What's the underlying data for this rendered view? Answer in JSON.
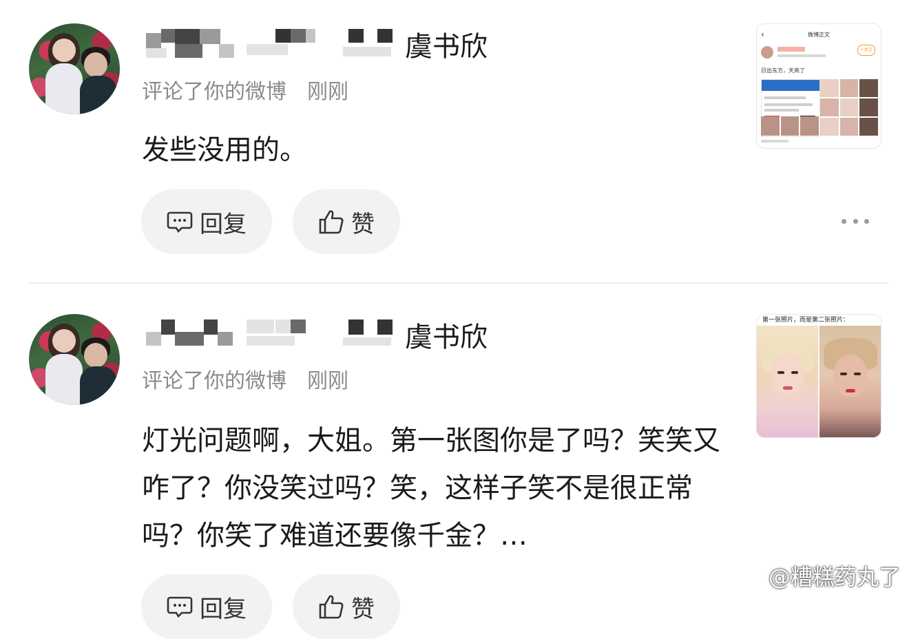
{
  "comments": [
    {
      "username": "虞书欣",
      "action": "评论了你的微博",
      "time": "刚刚",
      "text": "发些没用的。",
      "reply_label": "回复",
      "like_label": "赞",
      "thumbnail": {
        "title": "微博正文",
        "line": "日出东方，天亮了",
        "follow": "+关注"
      }
    },
    {
      "username": "虞书欣",
      "action": "评论了你的微博",
      "time": "刚刚",
      "text": "灯光问题啊，大姐。第一张图你是了吗？笑笑又咋了？你没笑过吗？笑，这样子笑不是很正常吗？你笑了难道还要像千金？…",
      "reply_label": "回复",
      "like_label": "赞",
      "thumbnail": {
        "caption": "第一张照片，而是第二张照片："
      }
    }
  ],
  "watermark": "@糟糕药丸了",
  "icons": {
    "reply": "comment-bubble-icon",
    "like": "thumbs-up-icon",
    "more": "more-dots-icon",
    "brand": "weibo-logo-icon"
  }
}
